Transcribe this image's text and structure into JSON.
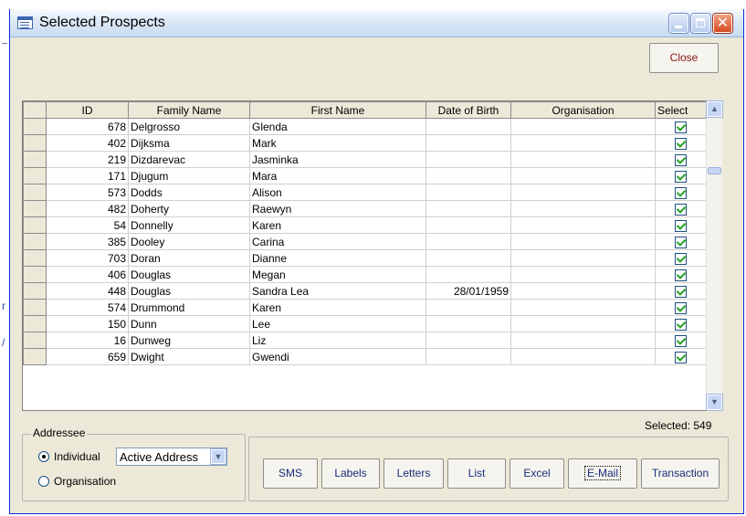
{
  "window": {
    "title": "Selected Prospects",
    "close_label": "Close"
  },
  "outside": {
    "glyph_r": "r",
    "glyph_slash": "/"
  },
  "grid": {
    "headers": [
      "ID",
      "Family Name",
      "First Name",
      "Date of Birth",
      "Organisation",
      "Select"
    ],
    "rows": [
      {
        "id": "678",
        "family": "Delgrosso",
        "first": "Glenda",
        "dob": "",
        "org": "",
        "selected": true
      },
      {
        "id": "402",
        "family": "Dijksma",
        "first": "Mark",
        "dob": "",
        "org": "",
        "selected": true
      },
      {
        "id": "219",
        "family": "Dizdarevac",
        "first": "Jasminka",
        "dob": "",
        "org": "",
        "selected": true
      },
      {
        "id": "171",
        "family": "Djugum",
        "first": "Mara",
        "dob": "",
        "org": "",
        "selected": true
      },
      {
        "id": "573",
        "family": "Dodds",
        "first": "Alison",
        "dob": "",
        "org": "",
        "selected": true
      },
      {
        "id": "482",
        "family": "Doherty",
        "first": "Raewyn",
        "dob": "",
        "org": "",
        "selected": true
      },
      {
        "id": "54",
        "family": "Donnelly",
        "first": "Karen",
        "dob": "",
        "org": "",
        "selected": true
      },
      {
        "id": "385",
        "family": "Dooley",
        "first": "Carina",
        "dob": "",
        "org": "",
        "selected": true
      },
      {
        "id": "703",
        "family": "Doran",
        "first": "Dianne",
        "dob": "",
        "org": "",
        "selected": true
      },
      {
        "id": "406",
        "family": "Douglas",
        "first": "Megan",
        "dob": "",
        "org": "",
        "selected": true
      },
      {
        "id": "448",
        "family": "Douglas",
        "first": "Sandra Lea",
        "dob": "28/01/1959",
        "org": "",
        "selected": true
      },
      {
        "id": "574",
        "family": "Drummond",
        "first": "Karen",
        "dob": "",
        "org": "",
        "selected": true
      },
      {
        "id": "150",
        "family": "Dunn",
        "first": "Lee",
        "dob": "",
        "org": "",
        "selected": true
      },
      {
        "id": "16",
        "family": "Dunweg",
        "first": "Liz",
        "dob": "",
        "org": "",
        "selected": true
      },
      {
        "id": "659",
        "family": "Dwight",
        "first": "Gwendi",
        "dob": "",
        "org": "",
        "selected": true
      }
    ]
  },
  "status": {
    "selected_text": "Selected: 549"
  },
  "addressee": {
    "legend": "Addressee",
    "individual_label": "Individual",
    "organisation_label": "Organisation",
    "selected_option": "Individual",
    "address_type": "Active Address"
  },
  "actions": {
    "sms": "SMS",
    "labels": "Labels",
    "letters": "Letters",
    "list": "List",
    "excel": "Excel",
    "email": "E-Mail",
    "transaction": "Transaction"
  },
  "colors": {
    "window_bg": "#ece9d8",
    "close_text": "#8a1313",
    "button_text": "#1a2c7a",
    "check": "#21a121"
  }
}
